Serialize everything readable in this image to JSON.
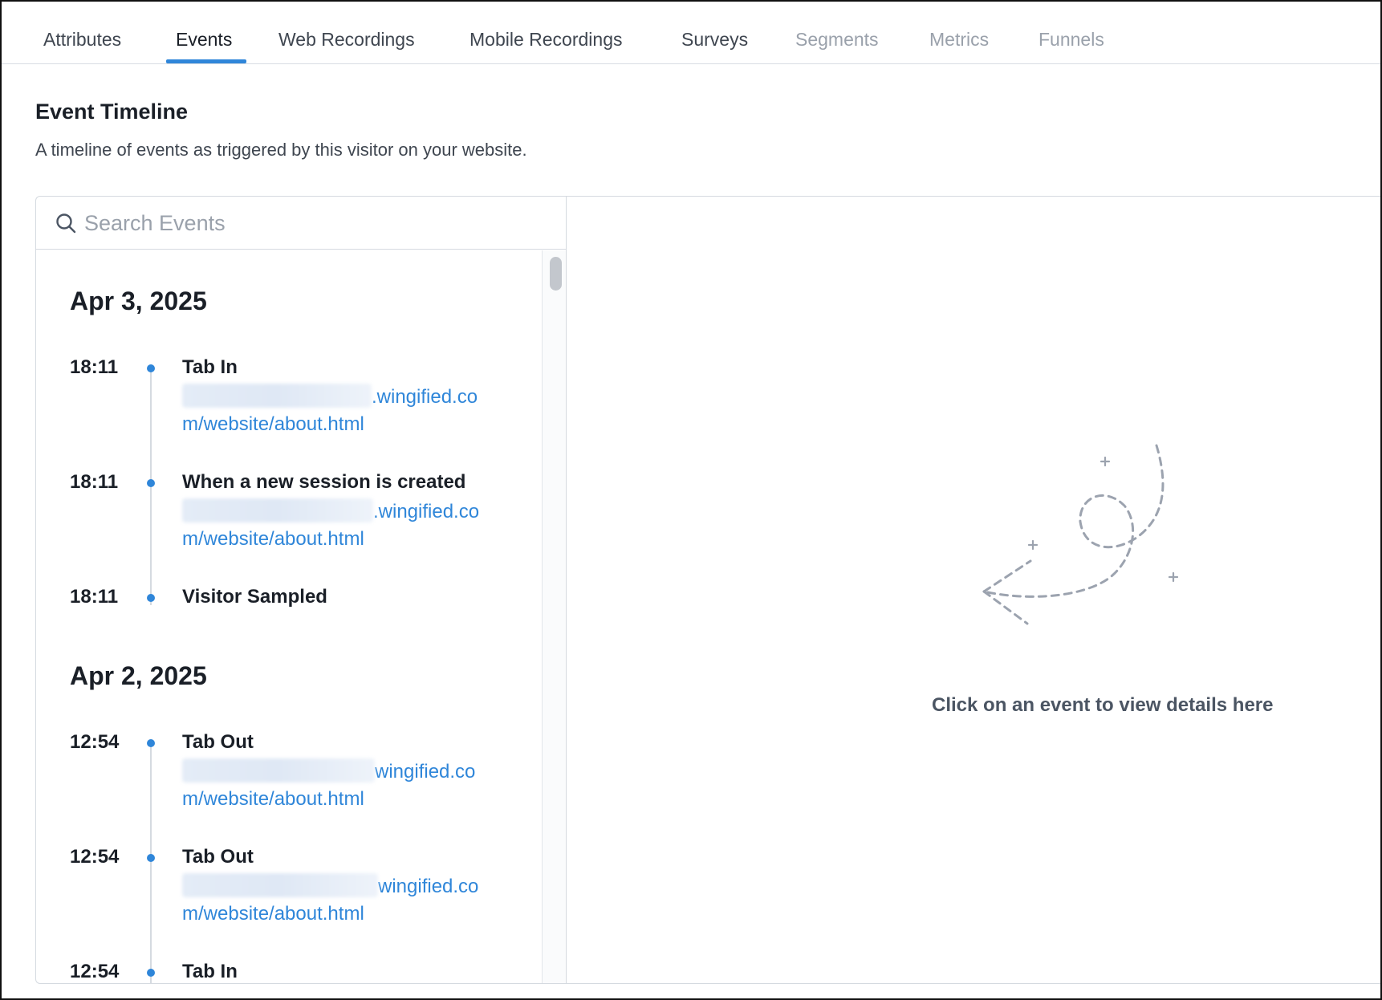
{
  "tabs": [
    {
      "label": "Attributes",
      "state": "normal"
    },
    {
      "label": "Events",
      "state": "active"
    },
    {
      "label": "Web Recordings",
      "state": "normal"
    },
    {
      "label": "Mobile Recordings",
      "state": "normal"
    },
    {
      "label": "Surveys",
      "state": "normal"
    },
    {
      "label": "Segments",
      "state": "disabled"
    },
    {
      "label": "Metrics",
      "state": "disabled"
    },
    {
      "label": "Funnels",
      "state": "disabled"
    }
  ],
  "header": {
    "title": "Event Timeline",
    "subtitle": "A timeline of events as triggered by this visitor on your website."
  },
  "search": {
    "placeholder": "Search Events",
    "value": ""
  },
  "timeline": {
    "groups": [
      {
        "date": "Apr 3, 2025",
        "events": [
          {
            "time": "18:11",
            "title": "Tab In",
            "url_line1": ".wingified.co",
            "url_line2": "m/website/about.html"
          },
          {
            "time": "18:11",
            "title": "When a new session is created",
            "url_line1": ".wingified.co",
            "url_line2": "m/website/about.html"
          },
          {
            "time": "18:11",
            "title": "Visitor Sampled"
          }
        ]
      },
      {
        "date": "Apr 2, 2025",
        "events": [
          {
            "time": "12:54",
            "title": "Tab Out",
            "url_line1": "wingified.co",
            "url_line2": "m/website/about.html"
          },
          {
            "time": "12:54",
            "title": "Tab Out",
            "url_line1": "wingified.co",
            "url_line2": "m/website/about.html"
          },
          {
            "time": "12:54",
            "title": "Tab In"
          }
        ]
      }
    ]
  },
  "details": {
    "empty_message": "Click on an event to view details here"
  },
  "icons": {
    "search": "search-icon",
    "illustration": "dashed-arrow-illustration"
  },
  "colors": {
    "accent": "#2f86d9",
    "border": "#d5dae0",
    "text_primary": "#1a1f27",
    "text_muted": "#9aa1ab"
  }
}
